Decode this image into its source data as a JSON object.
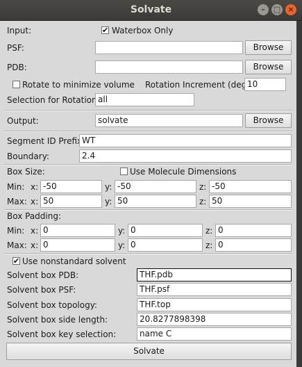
{
  "window": {
    "title": "Solvate",
    "controls": {
      "minimize": "–",
      "maximize": "□",
      "close": "×"
    }
  },
  "input": {
    "label": "Input:",
    "waterbox_only": {
      "label": "Waterbox Only",
      "checked": true,
      "mark": "✔"
    },
    "psf": {
      "label": "PSF:",
      "value": "",
      "button": "Browse"
    },
    "pdb": {
      "label": "PDB:",
      "value": "",
      "button": "Browse"
    }
  },
  "rotation": {
    "minimize_label": "Rotate to minimize volume",
    "minimize_checked": false,
    "increment_label": "Rotation Increment (deg):",
    "increment_value": "10",
    "selection_label": "Selection for Rotation:",
    "selection_value": "all"
  },
  "output": {
    "label": "Output:",
    "value": "solvate",
    "button": "Browse"
  },
  "segment": {
    "prefix_label": "Segment ID Prefix:",
    "prefix_value": "WT",
    "boundary_label": "Boundary:",
    "boundary_value": "2.4"
  },
  "box_size": {
    "label": "Box Size:",
    "use_molecule_dimensions": {
      "label": "Use Molecule Dimensions",
      "checked": false
    },
    "min": {
      "label": "Min:",
      "x_label": "x:",
      "x": "-50",
      "y_label": "y:",
      "y": "-50",
      "z_label": "z:",
      "z": "-50"
    },
    "max": {
      "label": "Max:",
      "x_label": "x:",
      "x": "50",
      "y_label": "y:",
      "y": "50",
      "z_label": "z:",
      "z": "50"
    }
  },
  "box_padding": {
    "label": "Box Padding:",
    "min": {
      "label": "Min:",
      "x_label": "x:",
      "x": "0",
      "y_label": "y:",
      "y": "0",
      "z_label": "z:",
      "z": "0"
    },
    "max": {
      "label": "Max:",
      "x_label": "x:",
      "x": "0",
      "y_label": "y:",
      "y": "0",
      "z_label": "z:",
      "z": "0"
    }
  },
  "nonstandard": {
    "label": "Use nonstandard solvent",
    "checked": true,
    "mark": "✔",
    "pdb_label": "Solvent box PDB:",
    "pdb_value": "THF.pdb",
    "psf_label": "Solvent box PSF:",
    "psf_value": "THF.psf",
    "topology_label": "Solvent box topology:",
    "topology_value": "THF.top",
    "side_length_label": "Solvent box side length:",
    "side_length_value": "20.8277898398",
    "key_selection_label": "Solvent box key selection:",
    "key_selection_value": "name C"
  },
  "solvate_button": "Solvate"
}
